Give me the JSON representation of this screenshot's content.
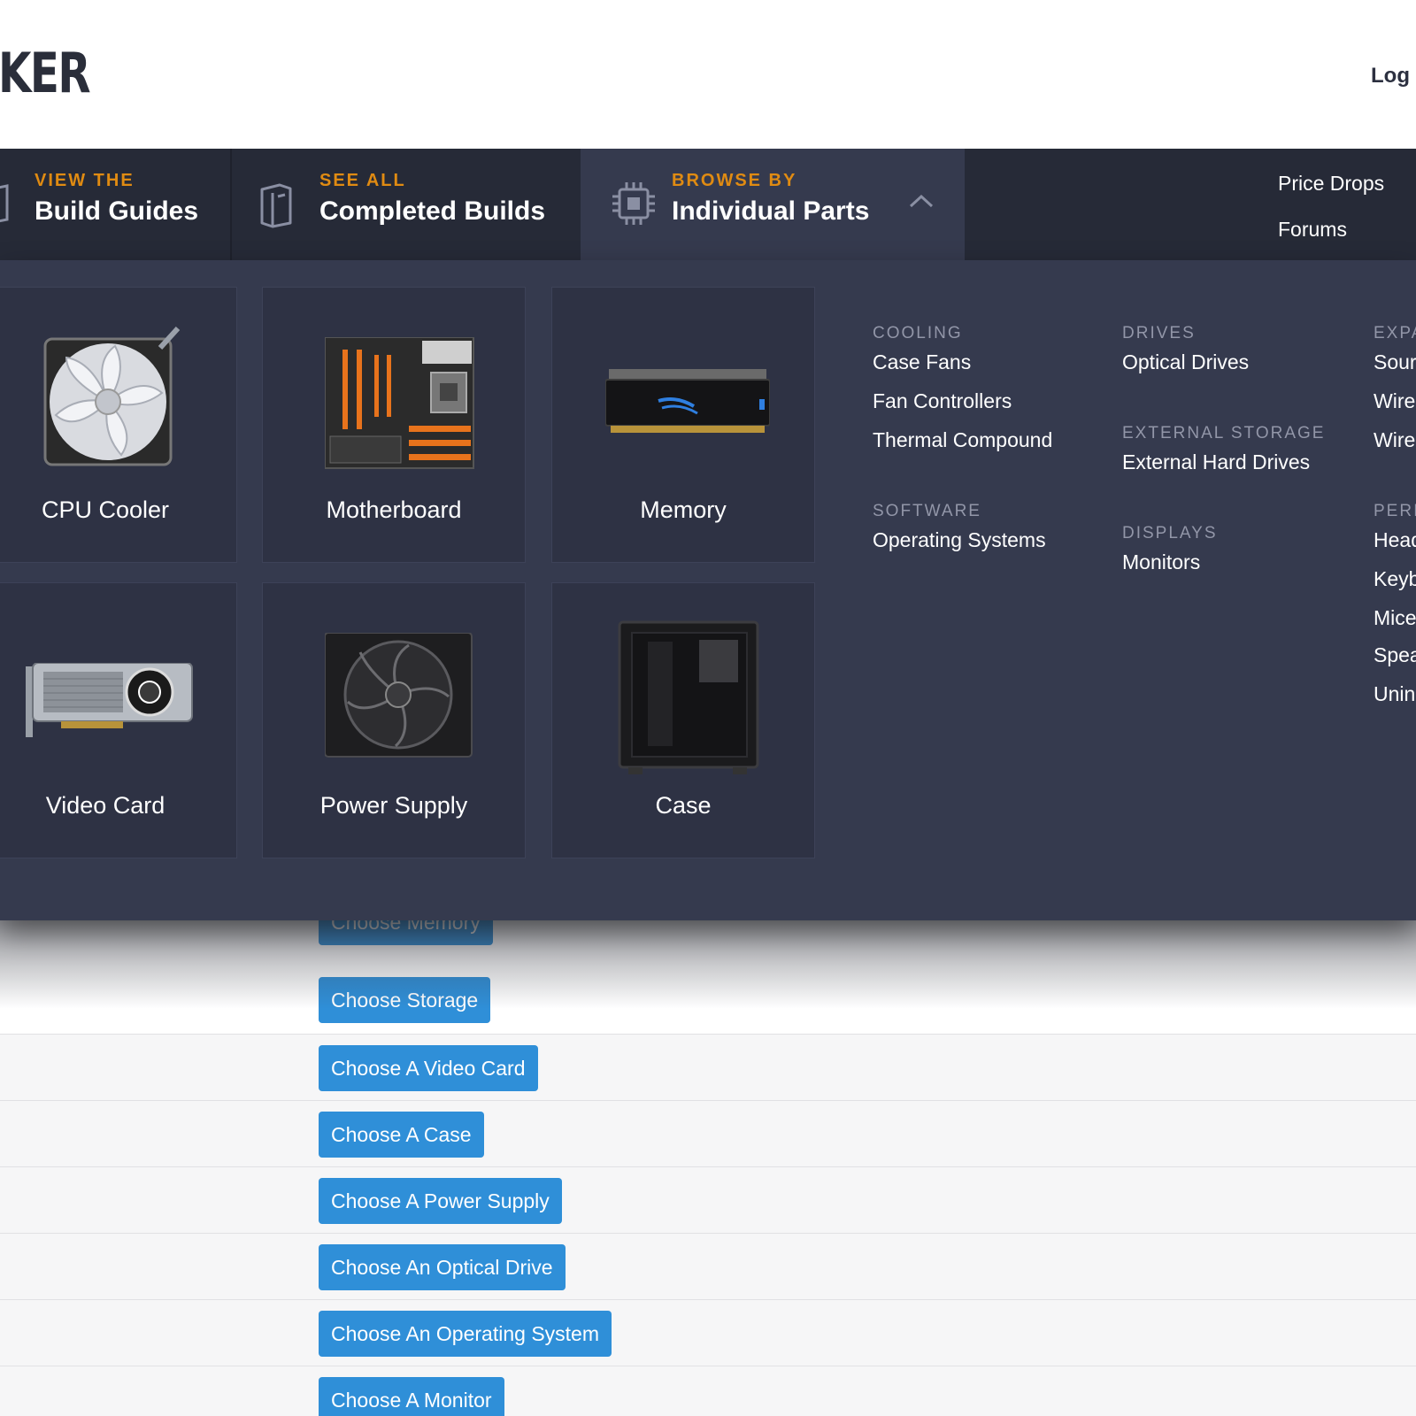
{
  "header": {
    "logo_text": "KER",
    "login_label": "Log I"
  },
  "nav": {
    "build_guides": {
      "pre": "VIEW THE",
      "main": "Build Guides"
    },
    "completed_builds": {
      "pre": "SEE ALL",
      "main": "Completed Builds"
    },
    "individual_parts": {
      "pre": "BROWSE BY",
      "main": "Individual Parts"
    },
    "price_drops": "Price Drops",
    "forums": "Forums"
  },
  "dropdown": {
    "cards": [
      {
        "label": "CPU Cooler",
        "icon": "cpu-cooler-icon"
      },
      {
        "label": "Motherboard",
        "icon": "motherboard-icon"
      },
      {
        "label": "Memory",
        "icon": "memory-icon"
      },
      {
        "label": "Video Card",
        "icon": "video-card-icon"
      },
      {
        "label": "Power Supply",
        "icon": "power-supply-icon"
      },
      {
        "label": "Case",
        "icon": "case-icon"
      }
    ],
    "categories": {
      "cooling": {
        "heading": "COOLING",
        "links": [
          "Case Fans",
          "Fan Controllers",
          "Thermal Compound"
        ]
      },
      "software": {
        "heading": "SOFTWARE",
        "links": [
          "Operating Systems"
        ]
      },
      "drives": {
        "heading": "DRIVES",
        "links": [
          "Optical Drives"
        ]
      },
      "external_storage": {
        "heading": "EXTERNAL STORAGE",
        "links": [
          "External Hard Drives"
        ]
      },
      "displays": {
        "heading": "DISPLAYS",
        "links": [
          "Monitors"
        ]
      },
      "expansion": {
        "heading": "EXPA",
        "links": [
          "Sour",
          "Wire",
          "Wire"
        ]
      },
      "peripherals": {
        "heading": "PERI",
        "links": [
          "Head",
          "Keyb",
          "Mice",
          "Spea",
          "Unin"
        ]
      }
    }
  },
  "list": {
    "buttons": [
      "Choose Memory",
      "Choose Storage",
      "Choose A Video Card",
      "Choose A Case",
      "Choose A Power Supply",
      "Choose An Optical Drive",
      "Choose An Operating System",
      "Choose A Monitor"
    ]
  },
  "colors": {
    "nav_bg": "#262a37",
    "panel_bg": "#353a4e",
    "accent": "#e08b12",
    "button": "#2f8fd8"
  }
}
